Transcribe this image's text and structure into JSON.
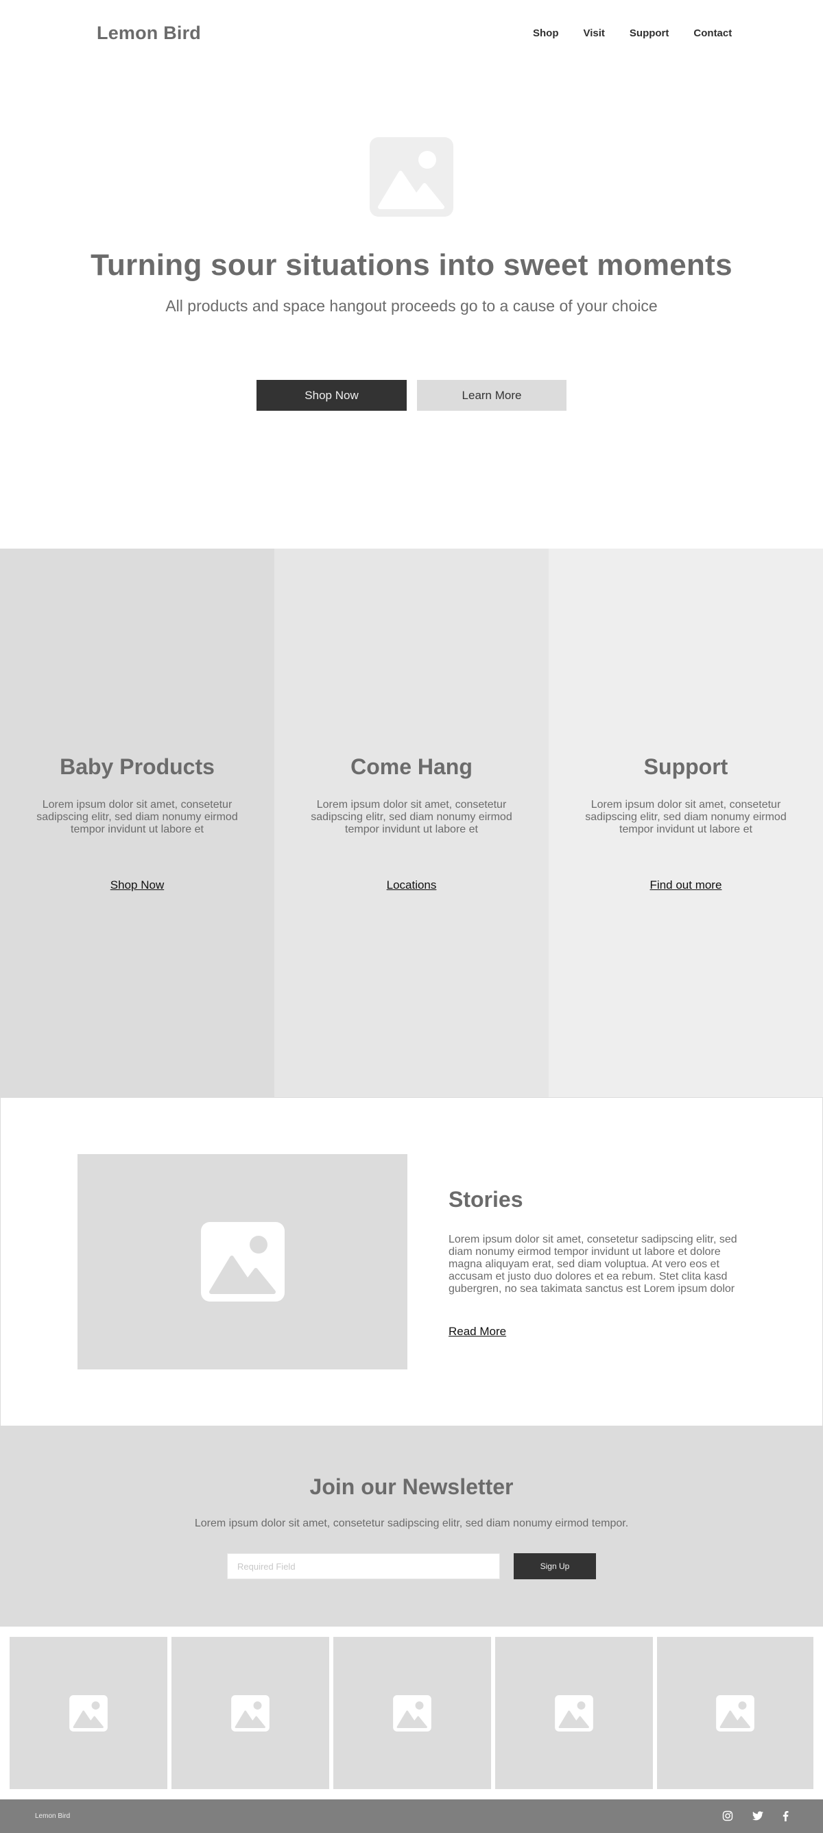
{
  "header": {
    "logo": "Lemon Bird",
    "nav": [
      "Shop",
      "Visit",
      "Support",
      "Contact"
    ]
  },
  "hero": {
    "image_icon": "image-placeholder-icon",
    "title": "Turning sour situations into sweet moments",
    "subtitle": "All products and space hangout proceeds go to a cause of your choice",
    "primary_button": "Shop Now",
    "secondary_button": "Learn More"
  },
  "columns": [
    {
      "title": "Baby Products",
      "text": "Lorem ipsum dolor sit amet, consetetur sadipscing elitr, sed diam nonumy eirmod tempor invidunt ut labore et",
      "link": "Shop Now",
      "bg": "#dcdcdc"
    },
    {
      "title": "Come Hang",
      "text": "Lorem ipsum dolor sit amet, consetetur sadipscing elitr, sed diam nonumy eirmod tempor invidunt ut labore et",
      "link": "Locations",
      "bg": "#e6e6e6"
    },
    {
      "title": "Support",
      "text": "Lorem ipsum dolor sit amet, consetetur sadipscing elitr, sed diam nonumy eirmod tempor invidunt ut labore et",
      "link": "Find out more",
      "bg": "#eeeeee"
    }
  ],
  "stories": {
    "title": "Stories",
    "text": "Lorem ipsum dolor sit amet, consetetur sadipscing elitr, sed diam nonumy eirmod tempor invidunt ut labore et dolore magna aliquyam erat, sed diam voluptua. At vero eos et accusam et justo duo dolores et ea rebum. Stet clita kasd gubergren, no sea takimata sanctus est Lorem ipsum dolor",
    "link": "Read More"
  },
  "newsletter": {
    "title": "Join our Newsletter",
    "text": "Lorem ipsum dolor sit amet, consetetur sadipscing elitr, sed diam nonumy eirmod tempor.",
    "input_placeholder": "Required Field",
    "button": "Sign Up"
  },
  "gallery": {
    "count": 5,
    "icon": "image-placeholder-icon"
  },
  "footer": {
    "logo": "Lemon Bird",
    "social_icons": [
      "instagram-icon",
      "twitter-icon",
      "facebook-icon"
    ]
  },
  "colors": {
    "dark_button": "#333333",
    "light_button": "#dcdcdc",
    "text": "#6b6b6b",
    "footer": "#7f7f7f"
  }
}
